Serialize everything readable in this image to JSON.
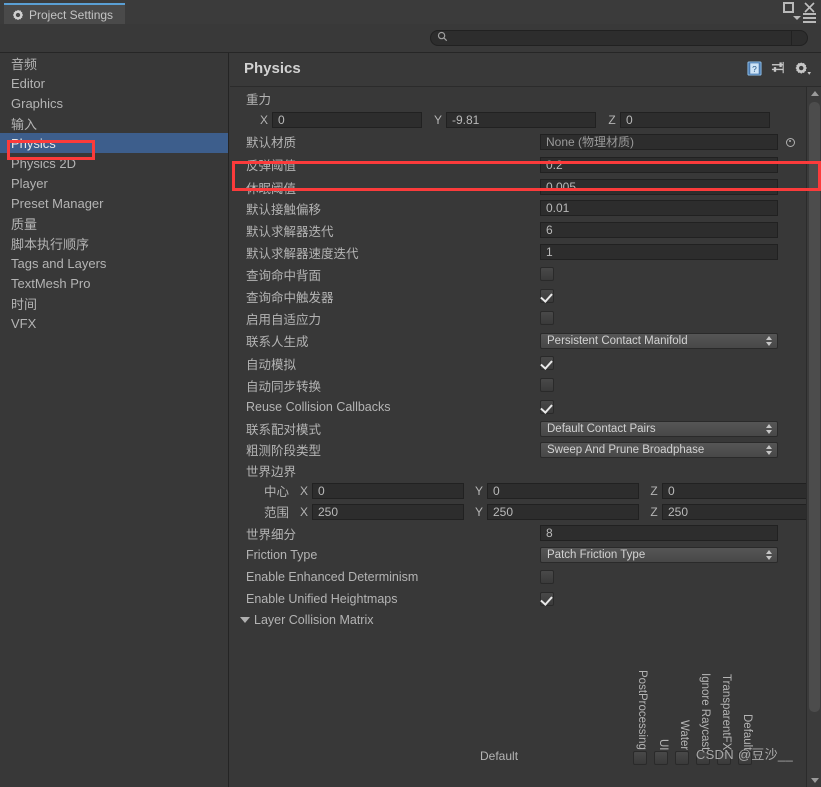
{
  "window": {
    "tab_title": "Project Settings",
    "tab_icon": "gear-icon",
    "maximize_label": "",
    "close_label": "",
    "menu_label": ""
  },
  "search": {
    "value": "",
    "placeholder": "",
    "icon": "search-icon"
  },
  "sidebar": {
    "items": [
      {
        "label": "音频",
        "selected": false
      },
      {
        "label": "Editor",
        "selected": false
      },
      {
        "label": "Graphics",
        "selected": false
      },
      {
        "label": "输入",
        "selected": false
      },
      {
        "label": "Physics",
        "selected": true
      },
      {
        "label": "Physics 2D",
        "selected": false
      },
      {
        "label": "Player",
        "selected": false
      },
      {
        "label": "Preset Manager",
        "selected": false
      },
      {
        "label": "质量",
        "selected": false
      },
      {
        "label": "脚本执行顺序",
        "selected": false
      },
      {
        "label": "Tags and Layers",
        "selected": false
      },
      {
        "label": "TextMesh Pro",
        "selected": false
      },
      {
        "label": "时间",
        "selected": false
      },
      {
        "label": "VFX",
        "selected": false
      }
    ]
  },
  "panel": {
    "title": "Physics",
    "icons": [
      {
        "name": "help-icon",
        "label": "?"
      },
      {
        "name": "preset-icon",
        "label": ""
      },
      {
        "name": "settings-gear-icon",
        "label": ""
      }
    ]
  },
  "properties": {
    "gravity": {
      "label": "重力",
      "x_axis": "X",
      "x": "0",
      "y_axis": "Y",
      "y": "-9.81",
      "z_axis": "Z",
      "z": "0"
    },
    "default_material": {
      "label": "默认材质",
      "value": "None (物理材质)"
    },
    "bounce_threshold": {
      "label": "反弹阈值",
      "value": "0.2"
    },
    "sleep_threshold": {
      "label": "休眠阈值",
      "value": "0.005"
    },
    "default_contact_offset": {
      "label": "默认接触偏移",
      "value": "0.01"
    },
    "default_solver_iterations": {
      "label": "默认求解器迭代",
      "value": "6"
    },
    "default_solver_velocity_iterations": {
      "label": "默认求解器速度迭代",
      "value": "1"
    },
    "queries_hit_backfaces": {
      "label": "查询命中背面",
      "checked": false
    },
    "queries_hit_triggers": {
      "label": "查询命中触发器",
      "checked": true
    },
    "enable_adaptive_force": {
      "label": "启用自适应力",
      "checked": false
    },
    "contacts_generation": {
      "label": "联系人生成",
      "value": "Persistent Contact Manifold"
    },
    "auto_simulation": {
      "label": "自动模拟",
      "checked": true
    },
    "auto_sync_transforms": {
      "label": "自动同步转换",
      "checked": false
    },
    "reuse_collision_callbacks": {
      "label": "Reuse Collision Callbacks",
      "checked": true
    },
    "contact_pairs_mode": {
      "label": "联系配对模式",
      "value": "Default Contact Pairs"
    },
    "broadphase_type": {
      "label": "粗测阶段类型",
      "value": "Sweep And Prune Broadphase"
    },
    "world_bounds": {
      "label": "世界边界",
      "center": {
        "label": "中心",
        "x_axis": "X",
        "x": "0",
        "y_axis": "Y",
        "y": "0",
        "z_axis": "Z",
        "z": "0"
      },
      "extent": {
        "label": "范围",
        "x_axis": "X",
        "x": "250",
        "y_axis": "Y",
        "y": "250",
        "z_axis": "Z",
        "z": "250"
      }
    },
    "world_subdivisions": {
      "label": "世界细分",
      "value": "8"
    },
    "friction_type": {
      "label": "Friction Type",
      "value": "Patch Friction Type"
    },
    "enable_enhanced_determinism": {
      "label": "Enable Enhanced Determinism",
      "checked": false
    },
    "enable_unified_heightmaps": {
      "label": "Enable Unified Heightmaps",
      "checked": true
    },
    "layer_collision_matrix": {
      "label": "Layer Collision Matrix",
      "expanded": true,
      "column_labels": [
        "PostProcessing",
        "UI",
        "Water",
        "Ignore Raycast",
        "TransparentFX",
        "Default"
      ],
      "first_row_label": "Default"
    }
  },
  "watermark": "CSDN @豆沙__",
  "colors": {
    "accent_selection": "#3D5E8C",
    "annotation_red": "#FB3B3B",
    "panel_bg": "#383838",
    "field_bg": "#2D2D2D",
    "text": "#B4B4B4"
  }
}
